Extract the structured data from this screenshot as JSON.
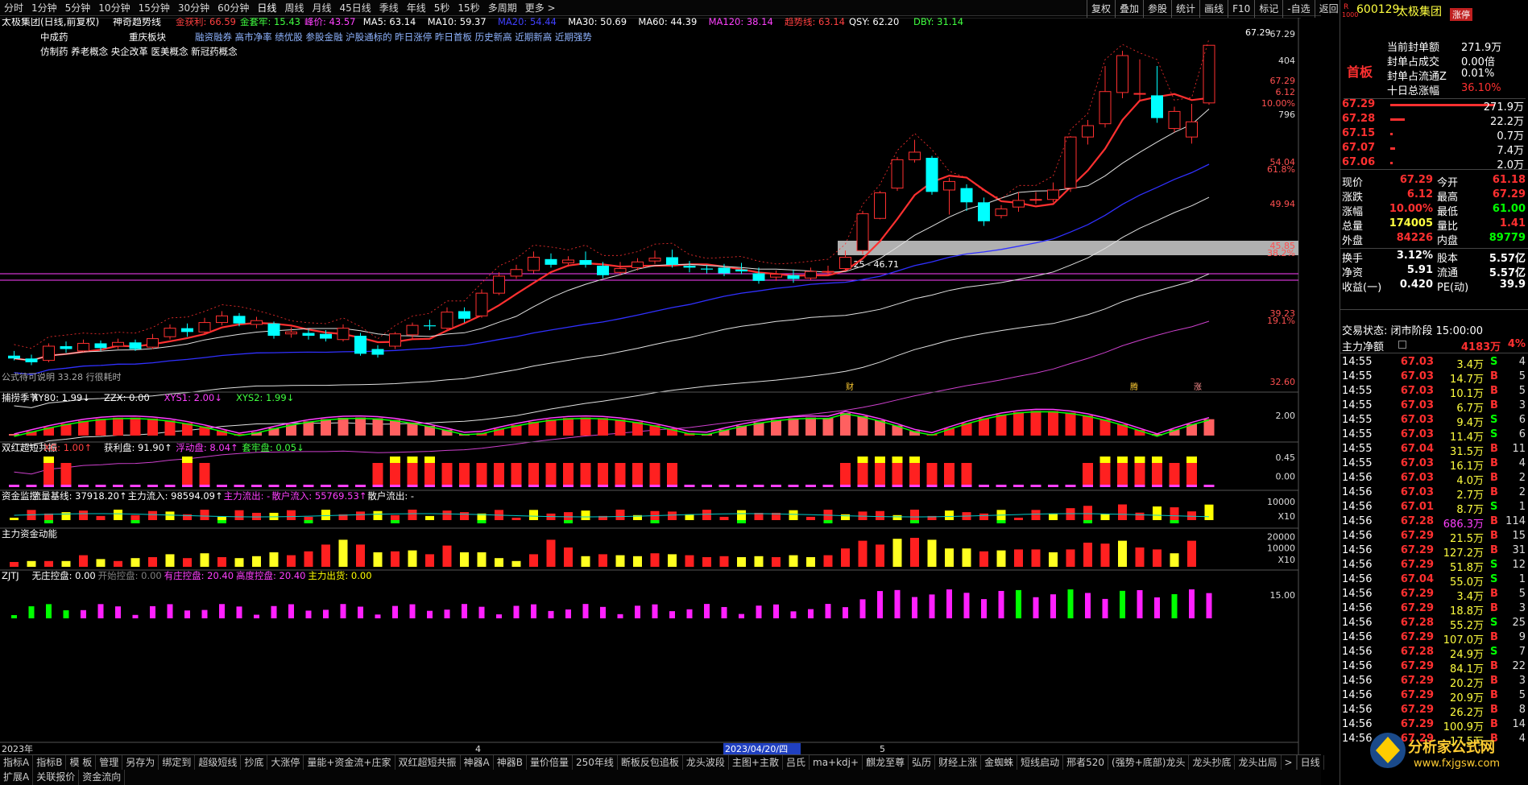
{
  "toolbar": {
    "items": [
      "分时",
      "1分钟",
      "5分钟",
      "10分钟",
      "15分钟",
      "30分钟",
      "60分钟",
      "日线",
      "周线",
      "月线",
      "45日线",
      "季线",
      "年线",
      "5秒",
      "15秒",
      "多周期",
      "更多 >"
    ],
    "right": [
      "复权",
      "叠加",
      "参股",
      "统计",
      "画线",
      "F10",
      "标记",
      "-自选",
      "返回"
    ]
  },
  "chart_header": {
    "title": "太极集团(日线,前复权)",
    "indicator": "神奇趋势线",
    "segs": [
      {
        "t": "金获利: 66.59",
        "c": "#ff4040"
      },
      {
        "t": "金套牢: 15.43",
        "c": "#40ff40"
      },
      {
        "t": "峰价: 43.57",
        "c": "#ff40ff"
      },
      {
        "t": "MA5: 63.14",
        "c": "#ffffff"
      },
      {
        "t": "MA10: 59.37",
        "c": "#ffffff"
      },
      {
        "t": "MA20: 54.44",
        "c": "#4040ff"
      },
      {
        "t": "MA30: 50.69",
        "c": "#ffffff"
      },
      {
        "t": "MA60: 44.39",
        "c": "#ffffff"
      },
      {
        "t": "MA120: 38.14",
        "c": "#ff40ff"
      },
      {
        "t": "趋势线: 63.14",
        "c": "#ff4040"
      },
      {
        "t": "QSY: 62.20",
        "c": "#ffffff"
      },
      {
        "t": "DBY: 31.14",
        "c": "#40ff40"
      }
    ]
  },
  "concepts": {
    "line1": [
      "中成药",
      "重庆板块"
    ],
    "line2": "融资融券 高市净率 绩优股 参股金融 沪股通标的 昨日涨停 昨日首板 历史新高 近期新高 近期强势",
    "line3": "仿制药 养老概念 央企改革 医美概念 新冠药概念"
  },
  "price_axis": [
    "67.29",
    "404",
    "67.29",
    "6.12",
    "10.00%",
    "796",
    "54.04",
    "61.8%",
    "49.94",
    "45.85",
    "38.2%",
    "39.23",
    "19.1%",
    "32.60"
  ],
  "annotations": {
    "high": "67.29",
    "zone": "46.25 - 46.71",
    "bottom_text": "公式待可说明 33.28 行很耗时",
    "months": [
      "2023年",
      "4",
      "2023/04/20/四",
      "5"
    ],
    "markers": [
      "财",
      "腾",
      "涨"
    ]
  },
  "chart_data": [
    {
      "type": "candlestick",
      "title": "太极集团(日线,前复权)",
      "ylim": [
        32.6,
        67.29
      ],
      "candles": [
        [
          34.5,
          34.2,
          35.0,
          34.0
        ],
        [
          34.2,
          33.8,
          34.6,
          33.5
        ],
        [
          34.0,
          35.5,
          35.8,
          33.8
        ],
        [
          35.5,
          35.2,
          36.0,
          34.8
        ],
        [
          35.0,
          35.8,
          36.2,
          34.9
        ],
        [
          35.8,
          35.3,
          36.1,
          35.0
        ],
        [
          35.5,
          35.9,
          36.3,
          35.2
        ],
        [
          35.9,
          35.2,
          36.2,
          35.0
        ],
        [
          35.4,
          36.3,
          36.8,
          35.2
        ],
        [
          36.5,
          37.4,
          37.8,
          36.2
        ],
        [
          37.4,
          37.0,
          37.9,
          36.5
        ],
        [
          37.0,
          38.0,
          38.5,
          36.8
        ],
        [
          38.0,
          38.7,
          39.2,
          37.7
        ],
        [
          38.7,
          37.9,
          39.0,
          37.6
        ],
        [
          37.8,
          38.2,
          38.6,
          37.4
        ],
        [
          37.9,
          36.6,
          38.1,
          36.3
        ],
        [
          36.8,
          37.0,
          37.5,
          36.4
        ],
        [
          36.9,
          36.6,
          37.3,
          36.2
        ],
        [
          36.8,
          36.3,
          37.2,
          36.0
        ],
        [
          36.2,
          37.4,
          37.8,
          36.0
        ],
        [
          36.6,
          34.7,
          36.9,
          34.5
        ],
        [
          35.2,
          34.6,
          35.6,
          34.3
        ],
        [
          35.5,
          36.8,
          37.0,
          35.2
        ],
        [
          36.7,
          37.7,
          38.0,
          36.3
        ],
        [
          37.7,
          37.6,
          38.3,
          37.2
        ],
        [
          37.4,
          39.1,
          39.6,
          37.2
        ],
        [
          39.2,
          38.4,
          39.6,
          38.0
        ],
        [
          38.7,
          41.1,
          41.5,
          38.5
        ],
        [
          41.1,
          42.9,
          43.3,
          40.9
        ],
        [
          42.9,
          43.6,
          44.1,
          42.6
        ],
        [
          43.5,
          44.9,
          45.5,
          43.2
        ],
        [
          44.7,
          44.1,
          45.3,
          43.8
        ],
        [
          44.3,
          44.6,
          45.0,
          43.9
        ],
        [
          44.6,
          44.1,
          45.5,
          43.8
        ],
        [
          44.0,
          43.0,
          44.4,
          42.7
        ],
        [
          43.3,
          43.7,
          44.4,
          43.0
        ],
        [
          43.8,
          44.4,
          44.8,
          43.5
        ],
        [
          44.5,
          44.8,
          45.6,
          44.2
        ],
        [
          44.9,
          44.1,
          45.7,
          43.8
        ],
        [
          44.0,
          43.8,
          44.5,
          43.3
        ],
        [
          43.7,
          43.6,
          44.1,
          43.2
        ],
        [
          43.8,
          43.2,
          44.2,
          42.9
        ],
        [
          43.6,
          43.4,
          44.3,
          43.1
        ],
        [
          43.2,
          42.4,
          43.8,
          42.1
        ],
        [
          42.8,
          43.1,
          43.5,
          42.4
        ],
        [
          43.0,
          42.6,
          43.6,
          42.2
        ],
        [
          42.7,
          43.4,
          43.8,
          42.5
        ],
        [
          43.4,
          43.4,
          44.0,
          43.0
        ],
        [
          43.7,
          44.9,
          45.6,
          43.5
        ],
        [
          45.6,
          49.5,
          49.8,
          45.2
        ],
        [
          49.0,
          51.7,
          51.9,
          48.9
        ],
        [
          52.2,
          55.2,
          55.5,
          51.9
        ],
        [
          55.2,
          56.0,
          57.3,
          54.9
        ],
        [
          55.4,
          51.8,
          55.6,
          51.5
        ],
        [
          52.0,
          52.9,
          53.3,
          49.4
        ],
        [
          52.2,
          50.7,
          52.6,
          49.8
        ],
        [
          50.7,
          48.7,
          51.2,
          48.2
        ],
        [
          49.3,
          50.0,
          50.4,
          49.0
        ],
        [
          50.2,
          50.9,
          51.8,
          49.7
        ],
        [
          51.0,
          51.0,
          51.8,
          50.5
        ],
        [
          51.0,
          52.0,
          52.8,
          50.7
        ],
        [
          52.2,
          57.6,
          57.7,
          51.8
        ],
        [
          57.6,
          58.8,
          59.4,
          56.8
        ],
        [
          59.0,
          62.4,
          65.1,
          58.6
        ],
        [
          62.3,
          66.2,
          66.7,
          61.7
        ],
        [
          62.2,
          62.2,
          65.8,
          61.5
        ],
        [
          62.0,
          59.6,
          65.1,
          59.1
        ],
        [
          58.5,
          60.3,
          60.8,
          58.1
        ],
        [
          57.6,
          59.2,
          61.1,
          56.9
        ],
        [
          61.2,
          67.29,
          67.29,
          61.0
        ]
      ]
    },
    {
      "type": "bar",
      "title": "捕捞季节",
      "legend": [
        {
          "t": "捕捞季节",
          "c": "#ffffff"
        },
        {
          "t": "XY80: 1.99↓",
          "c": "#ffffff"
        },
        {
          "t": "ZZX: 0.00",
          "c": "#ffffff"
        },
        {
          "t": "XYS1: 2.00↓",
          "c": "#ff40ff"
        },
        {
          "t": "XYS2: 1.99↓",
          "c": "#40ff40"
        }
      ],
      "axis": [
        "2.00"
      ]
    },
    {
      "type": "bar",
      "title": "双红超短共振",
      "legend": [
        {
          "t": "双红超短共振",
          "c": "#ffffff"
        },
        {
          "t": "XG: 1.00↑",
          "c": "#ff4040"
        },
        {
          "t": "获利盘: 91.90↑",
          "c": "#ffffff"
        },
        {
          "t": "浮动盘: 8.04↑",
          "c": "#ff40ff"
        },
        {
          "t": "套牢盘: 0.05↓",
          "c": "#40ff40"
        }
      ],
      "axis": [
        "0.45",
        "0.00"
      ]
    },
    {
      "type": "bar",
      "title": "资金监控",
      "legend": [
        {
          "t": "资金监控",
          "c": "#ffffff"
        },
        {
          "t": "流量基线: 37918.20↑",
          "c": "#ffffff"
        },
        {
          "t": "主力流入: 98594.09↑",
          "c": "#ffffff"
        },
        {
          "t": "主力流出: -",
          "c": "#ff40ff"
        },
        {
          "t": "散户流入: 55769.53↑",
          "c": "#ff40ff"
        },
        {
          "t": "散户流出: -",
          "c": "#ffffff"
        }
      ],
      "axis": [
        "10000",
        "X10"
      ]
    },
    {
      "type": "bar",
      "title": "主力资金动能",
      "legend": [
        {
          "t": "主力资金动能",
          "c": "#ffffff"
        }
      ],
      "axis": [
        "20000",
        "10000",
        "X10"
      ],
      "values": [
        0.5,
        0.6,
        0.6,
        0.6,
        1.2,
        0.8,
        0.6,
        0.9,
        1.0,
        1.3,
        0.9,
        1.4,
        1.0,
        0.9,
        1.1,
        1.5,
        1.2,
        1.6,
        2.3,
        2.8,
        2.3,
        1.5,
        1.6,
        1.7,
        1.3,
        2.2,
        1.5,
        1.5,
        0.9,
        0.6,
        1.3,
        2.8,
        2.0,
        1.1,
        1.3,
        1.2,
        1.1,
        1.4,
        1.3,
        1.2,
        1.0,
        1.1,
        1.0,
        1.1,
        1.0,
        1.2,
        1.0,
        1.2,
        1.9,
        2.7,
        2.3,
        2.9,
        3.0,
        2.8,
        1.9,
        1.9,
        1.6,
        1.7,
        1.8,
        1.8,
        1.5,
        1.8,
        2.5,
        2.4,
        2.7,
        2.0,
        1.8,
        1.4,
        2.7
      ],
      "colors": [
        "r",
        "y",
        "r",
        "y",
        "r",
        "y",
        "r",
        "y",
        "r",
        "y",
        "r",
        "y",
        "r",
        "y",
        "y",
        "y",
        "r",
        "r",
        "r",
        "y",
        "r",
        "y",
        "r",
        "y",
        "r",
        "r",
        "y",
        "y",
        "y",
        "y",
        "r",
        "r",
        "r",
        "y",
        "r",
        "y",
        "y",
        "r",
        "y",
        "r",
        "r",
        "r",
        "y",
        "y",
        "r",
        "y",
        "y",
        "r",
        "r",
        "r",
        "r",
        "y",
        "r",
        "y",
        "y",
        "y",
        "r",
        "y",
        "r",
        "r",
        "y",
        "r",
        "r",
        "r",
        "y",
        "r",
        "r",
        "y",
        "r"
      ]
    },
    {
      "type": "bar",
      "title": "ZJTJ",
      "legend": [
        {
          "t": "ZJTJ",
          "c": "#ffffff"
        },
        {
          "t": "无庄控盘: 0.00",
          "c": "#ffffff"
        },
        {
          "t": "开始控盘: 0.00",
          "c": "#808080"
        },
        {
          "t": "有庄控盘: 20.40",
          "c": "#ff40ff"
        },
        {
          "t": "高度控盘: 20.40",
          "c": "#ff40ff"
        },
        {
          "t": "主力出货: 0.00",
          "c": "#ffff00"
        }
      ],
      "axis": [
        "15.00"
      ]
    }
  ],
  "bottom_tabs": [
    "指标A",
    "指标B",
    "模 板",
    "管理",
    "另存为",
    "绑定到",
    "超级短线",
    "抄底",
    "大涨停",
    "量能+资金流+庄家",
    "双红超短共振",
    "神器A",
    "神器B",
    "量价倍量",
    "250年线",
    "断板反包追板",
    "龙头波段",
    "主图+主散",
    "吕氏",
    "ma+kdj+",
    "麒龙至尊",
    "弘历",
    "财经上涨",
    "金蜘蛛",
    "短线启动",
    "邢者520",
    "(强势+底部)龙头",
    "龙头抄底",
    "龙头出局",
    ">"
  ],
  "bottom_tabs2": [
    "扩展A",
    "关联报价",
    "资金流向"
  ],
  "bottom_right": "日线",
  "quote": {
    "code": "600129",
    "name": "太极集团",
    "tag": "涨停",
    "prefix_r": "R",
    "prefix_1000": "1000",
    "seal": [
      [
        "当前封单额",
        "271.9万"
      ],
      [
        "封单占成交",
        "0.00倍"
      ],
      [
        "封单占流通Z",
        "0.01%"
      ],
      [
        "十日总涨幅",
        "36.10%"
      ]
    ],
    "first_board": "首板",
    "book": [
      [
        "67.29",
        "271.9万"
      ],
      [
        "67.28",
        "22.2万"
      ],
      [
        "67.15",
        "0.7万"
      ],
      [
        "67.07",
        "7.4万"
      ],
      [
        "67.06",
        "2.0万"
      ]
    ],
    "stats": [
      [
        "现价",
        "67.29",
        "今开",
        "61.18"
      ],
      [
        "涨跌",
        "6.12",
        "最高",
        "67.29"
      ],
      [
        "涨幅",
        "10.00%",
        "最低",
        "61.00"
      ],
      [
        "总量",
        "174005",
        "量比",
        "1.41"
      ],
      [
        "外盘",
        "84226",
        "内盘",
        "89779"
      ],
      [
        "换手",
        "3.12%",
        "股本",
        "5.57亿"
      ],
      [
        "净资",
        "5.91",
        "流通",
        "5.57亿"
      ],
      [
        "收益(一)",
        "0.420",
        "PE(动)",
        "39.9"
      ]
    ],
    "status": "交易状态: 闭市阶段 15:00:00",
    "net_flow": [
      "主力净额",
      "4183万",
      "4%"
    ]
  },
  "ticks": [
    [
      "14:55",
      "67.03",
      "3.4万",
      "S",
      "4"
    ],
    [
      "14:55",
      "67.03",
      "14.7万",
      "B",
      "5"
    ],
    [
      "14:55",
      "67.03",
      "10.1万",
      "B",
      "5"
    ],
    [
      "14:55",
      "67.03",
      "6.7万",
      "B",
      "3"
    ],
    [
      "14:55",
      "67.03",
      "9.4万",
      "S",
      "6"
    ],
    [
      "14:55",
      "67.03",
      "11.4万",
      "S",
      "6"
    ],
    [
      "14:55",
      "67.04",
      "31.5万",
      "B",
      "11"
    ],
    [
      "14:55",
      "67.03",
      "16.1万",
      "B",
      "4"
    ],
    [
      "14:56",
      "67.03",
      "4.0万",
      "B",
      "2"
    ],
    [
      "14:56",
      "67.03",
      "2.7万",
      "B",
      "2"
    ],
    [
      "14:56",
      "67.01",
      "8.7万",
      "S",
      "1"
    ],
    [
      "14:56",
      "67.28",
      "686.3万",
      "B",
      "114"
    ],
    [
      "14:56",
      "67.29",
      "21.5万",
      "B",
      "15"
    ],
    [
      "14:56",
      "67.29",
      "127.2万",
      "B",
      "31"
    ],
    [
      "14:56",
      "67.29",
      "51.8万",
      "S",
      "12"
    ],
    [
      "14:56",
      "67.04",
      "55.0万",
      "S",
      "1"
    ],
    [
      "14:56",
      "67.29",
      "3.4万",
      "B",
      "5"
    ],
    [
      "14:56",
      "67.29",
      "18.8万",
      "B",
      "3"
    ],
    [
      "14:56",
      "67.28",
      "55.2万",
      "S",
      "25"
    ],
    [
      "14:56",
      "67.29",
      "107.0万",
      "B",
      "9"
    ],
    [
      "14:56",
      "67.28",
      "24.9万",
      "S",
      "7"
    ],
    [
      "14:56",
      "67.29",
      "84.1万",
      "B",
      "22"
    ],
    [
      "14:56",
      "67.29",
      "20.2万",
      "B",
      "3"
    ],
    [
      "14:56",
      "67.29",
      "20.9万",
      "B",
      "5"
    ],
    [
      "14:56",
      "67.29",
      "26.2万",
      "B",
      "8"
    ],
    [
      "14:56",
      "67.29",
      "100.9万",
      "B",
      "14"
    ],
    [
      "14:56",
      "67.29",
      "17.5万",
      "B",
      "4"
    ]
  ],
  "logo": {
    "text": "分析家公式网",
    "url": "www.fxjgsw.com"
  },
  "colors": {
    "up": "#ff3030",
    "down": "#00ffff",
    "magenta": "#ff40ff",
    "yellow": "#ffff00",
    "white": "#ffffff",
    "green": "#00ff00"
  }
}
